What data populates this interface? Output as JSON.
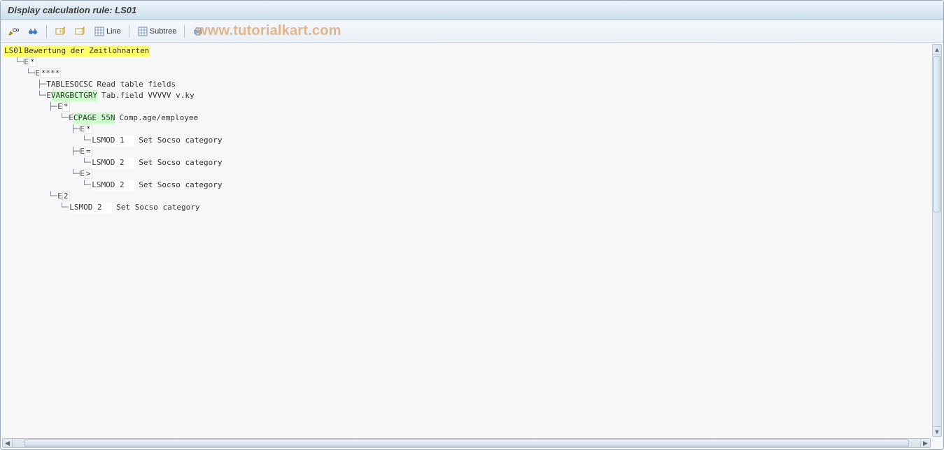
{
  "title": "Display calculation rule: LS01",
  "watermark": "www.tutorialkart.com",
  "toolbar": {
    "line_label": "Line",
    "subtree_label": "Subtree"
  },
  "tree": {
    "root_code": "LS01",
    "root_desc": "Bewertung der Zeitlohnarten",
    "nodes": [
      {
        "indent": 1,
        "conn": "└─",
        "e": true,
        "key": "*",
        "hl": "blue"
      },
      {
        "indent": 2,
        "conn": "└─",
        "e": true,
        "key": "****",
        "hl": "blue"
      },
      {
        "indent": 3,
        "conn": "├─",
        "cmd": "TABLESOCSC",
        "desc": "Read table fields"
      },
      {
        "indent": 3,
        "conn": "└─",
        "e": true,
        "cmd_hl": "VARGBCTGRY",
        "desc": "Tab.field VVVVV v.ky"
      },
      {
        "indent": 4,
        "conn": "├─",
        "e": true,
        "key": "*",
        "hl": "blue"
      },
      {
        "indent": 5,
        "conn": "└─",
        "e": true,
        "cmd_hl": "CPAGE 55N",
        "desc": "Comp.age/employee"
      },
      {
        "indent": 6,
        "conn": "├─",
        "e": true,
        "key": "*",
        "hl": "blue"
      },
      {
        "indent": 7,
        "conn": "└─",
        "cmd_box": "LSMOD 1",
        "desc": "Set Socso category"
      },
      {
        "indent": 6,
        "conn": "├─",
        "e": true,
        "key": "=",
        "hl": "blue"
      },
      {
        "indent": 7,
        "conn": "└─",
        "cmd_box": "LSMOD 2",
        "desc": "Set Socso category"
      },
      {
        "indent": 6,
        "conn": "└─",
        "e": true,
        "key": ">",
        "hl": "blue"
      },
      {
        "indent": 7,
        "conn": "└─",
        "cmd_box": "LSMOD 2",
        "desc": "Set Socso category"
      },
      {
        "indent": 4,
        "conn": "└─",
        "e": true,
        "key": "2",
        "hl": "blue"
      },
      {
        "indent": 5,
        "conn": "└─",
        "cmd_box": "LSMOD 2",
        "desc": "Set Socso category"
      }
    ]
  }
}
